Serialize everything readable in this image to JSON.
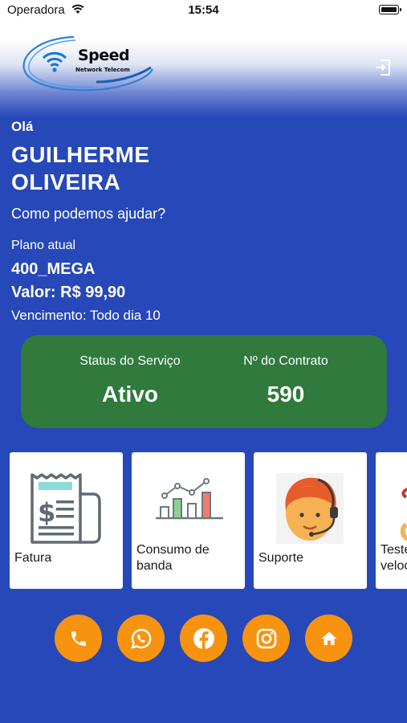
{
  "status_bar": {
    "carrier": "Operadora",
    "time": "15:54"
  },
  "header": {
    "brand": "Speed",
    "tagline": "Network Telecom"
  },
  "greeting": {
    "hello": "Olá",
    "name": "GUILHERME OLIVEIRA",
    "help": "Como podemos ajudar?"
  },
  "plan": {
    "label": "Plano atual",
    "name": "400_MEGA",
    "value": "Valor: R$ 99,90",
    "due": "Vencimento: Todo dia 10"
  },
  "service": {
    "status_label": "Status do Serviço",
    "status_value": "Ativo",
    "contract_label": "Nº do Contrato",
    "contract_value": "590"
  },
  "tiles": [
    {
      "label": "Fatura",
      "icon": "invoice-icon"
    },
    {
      "label": "Consumo de banda",
      "icon": "bandwidth-chart-icon"
    },
    {
      "label": "Suporte",
      "icon": "support-agent-icon"
    },
    {
      "label": "Teste de velocidade",
      "icon": "speed-test-icon"
    }
  ],
  "actions": [
    {
      "name": "phone",
      "icon": "phone-icon"
    },
    {
      "name": "whatsapp",
      "icon": "whatsapp-icon"
    },
    {
      "name": "facebook",
      "icon": "facebook-icon"
    },
    {
      "name": "instagram",
      "icon": "instagram-icon"
    },
    {
      "name": "home",
      "icon": "home-icon"
    }
  ],
  "colors": {
    "background": "#2748b8",
    "status_card": "#2f7a3c",
    "action_button": "#f7930e"
  }
}
